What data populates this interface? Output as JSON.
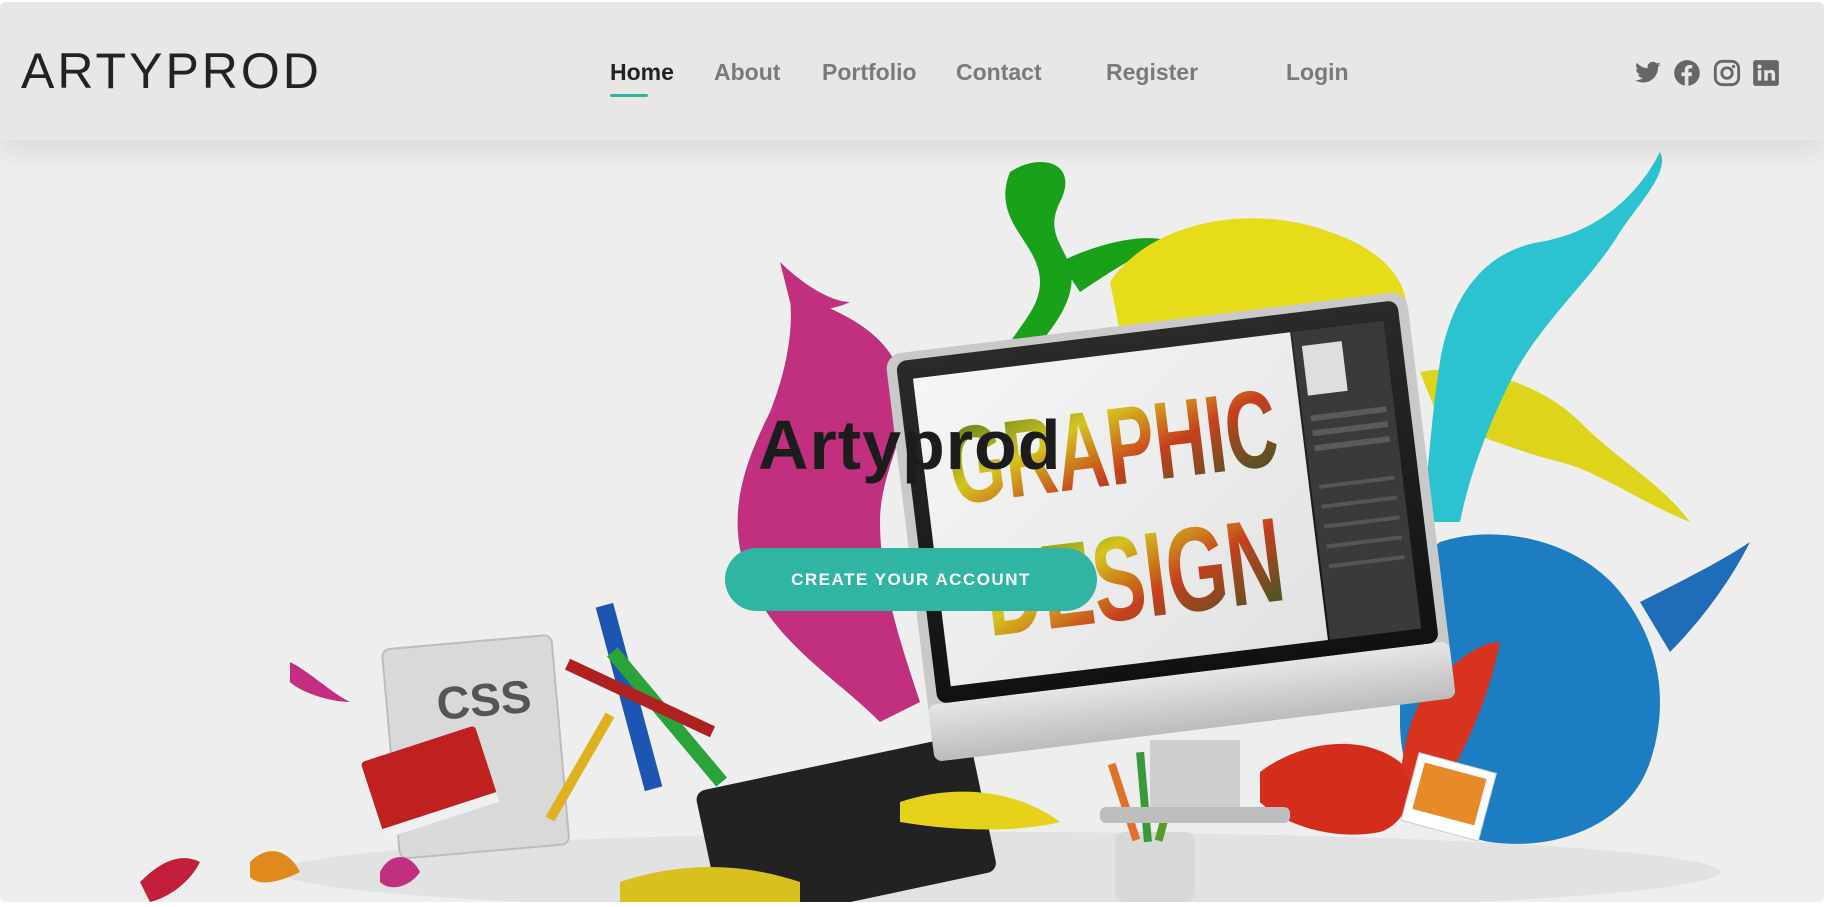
{
  "header": {
    "brand": "ARTYPROD",
    "nav": [
      {
        "label": "Home",
        "active": true
      },
      {
        "label": "About",
        "active": false
      },
      {
        "label": "Portfolio",
        "active": false
      },
      {
        "label": "Contact",
        "active": false
      },
      {
        "label": "Register",
        "active": false
      },
      {
        "label": "Login",
        "active": false
      }
    ],
    "social": [
      "twitter-icon",
      "facebook-icon",
      "instagram-icon",
      "linkedin-icon"
    ]
  },
  "hero": {
    "title": "Artyprod",
    "cta_label": "CREATE YOUR ACCOUNT",
    "image_text": {
      "monitor_line1": "GRAPHIC",
      "monitor_line2": "DESIGN",
      "css_file": "CSS"
    }
  },
  "colors": {
    "accent": "#30b5a3",
    "nav_bg": "#e8e7e5",
    "page_bg": "#eeeeee",
    "text_dark": "#222222",
    "text_muted": "#7a7a7a"
  }
}
